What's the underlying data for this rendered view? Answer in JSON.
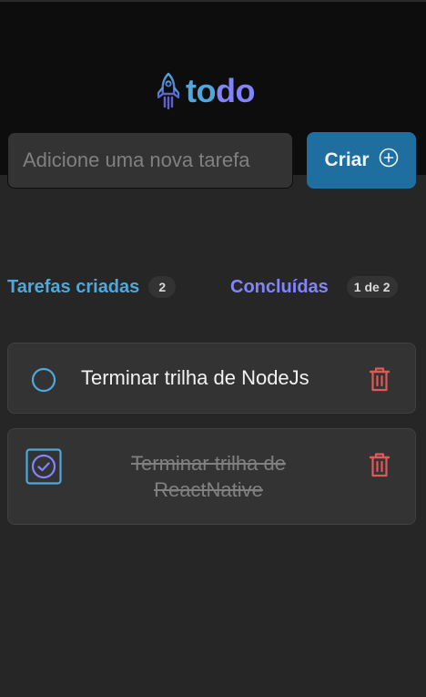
{
  "app": {
    "logo_part1": "to",
    "logo_part2": "do",
    "logo_icon": "rocket-icon"
  },
  "new_task": {
    "placeholder": "Adicione uma nova tarefa",
    "value": ""
  },
  "create_button": {
    "label": "Criar",
    "icon": "plus-circle-icon"
  },
  "summary": {
    "created_label": "Tarefas criadas",
    "created_count": "2",
    "done_label": "Concluídas",
    "done_count": "1 de 2"
  },
  "tasks": [
    {
      "text": "Terminar trilha de NodeJs",
      "completed": false
    },
    {
      "text": "Terminar trilha de ReactNative",
      "completed": true
    }
  ],
  "colors": {
    "blue": "#4ea8de",
    "purple": "#8284fa",
    "button": "#1e6f9f",
    "danger": "#e25858",
    "background": "#262626",
    "header": "#0d0d0d",
    "card": "#333333"
  }
}
